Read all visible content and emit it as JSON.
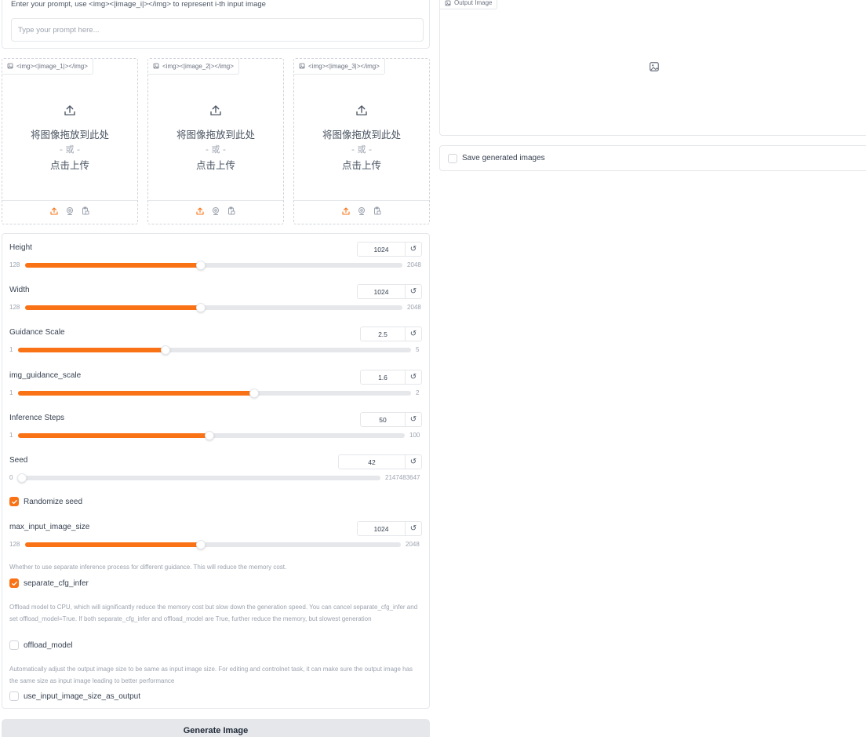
{
  "prompt": {
    "label": "Enter your prompt, use <img><|image_i|></img> to represent i-th input image",
    "placeholder": "Type your prompt here..."
  },
  "uploads": [
    {
      "tag": "<img><|image_1|></img>",
      "drop_text": "将图像拖放到此处",
      "or_text": "- 或 -",
      "click_text": "点击上传"
    },
    {
      "tag": "<img><|image_2|></img>",
      "drop_text": "将图像拖放到此处",
      "or_text": "- 或 -",
      "click_text": "点击上传"
    },
    {
      "tag": "<img><|image_3|></img>",
      "drop_text": "将图像拖放到此处",
      "or_text": "- 或 -",
      "click_text": "点击上传"
    }
  ],
  "upload_footer_icons": [
    "upload-icon",
    "webcam-icon",
    "clipboard-icon"
  ],
  "sliders": [
    {
      "label": "Height",
      "value": "1024",
      "min": "128",
      "max": "2048",
      "fraction": 0.4667
    },
    {
      "label": "Width",
      "value": "1024",
      "min": "128",
      "max": "2048",
      "fraction": 0.4667
    },
    {
      "label": "Guidance Scale",
      "value": "2.5",
      "min": "1",
      "max": "5",
      "fraction": 0.375
    },
    {
      "label": "img_guidance_scale",
      "value": "1.6",
      "min": "1",
      "max": "2",
      "fraction": 0.6
    },
    {
      "label": "Inference Steps",
      "value": "50",
      "min": "1",
      "max": "100",
      "fraction": 0.495
    },
    {
      "label": "Seed",
      "value": "42",
      "min": "0",
      "max": "2147483647",
      "fraction": 0.0
    }
  ],
  "randomize_seed": {
    "label": "Randomize seed",
    "checked": true
  },
  "max_input_slider": {
    "label": "max_input_image_size",
    "value": "1024",
    "min": "128",
    "max": "2048",
    "fraction": 0.4667
  },
  "separate_cfg": {
    "description": "Whether to use separate inference process for different guidance. This will reduce the memory cost.",
    "label": "separate_cfg_infer",
    "checked": true
  },
  "offload": {
    "description": "Offload model to CPU, which will significantly reduce the memory cost but slow down the generation speed. You can cancel separate_cfg_infer and set offload_model=True. If both separate_cfg_infer and offload_model are True, further reduce the memory, but slowest generation",
    "label": "offload_model",
    "checked": false
  },
  "use_input_size": {
    "description": "Automatically adjust the output image size to be same as input image size. For editing and controlnet task, it can make sure the output image has the same size as input image leading to better performance",
    "label": "use_input_image_size_as_output",
    "checked": false
  },
  "generate_button": "Generate Image",
  "output": {
    "label": "Output Image"
  },
  "save_images": {
    "label": "Save generated images",
    "checked": false
  },
  "colors": {
    "accent": "#f97316",
    "border": "#e5e7eb",
    "muted": "#9ca3af"
  },
  "reset_symbol": "↺"
}
